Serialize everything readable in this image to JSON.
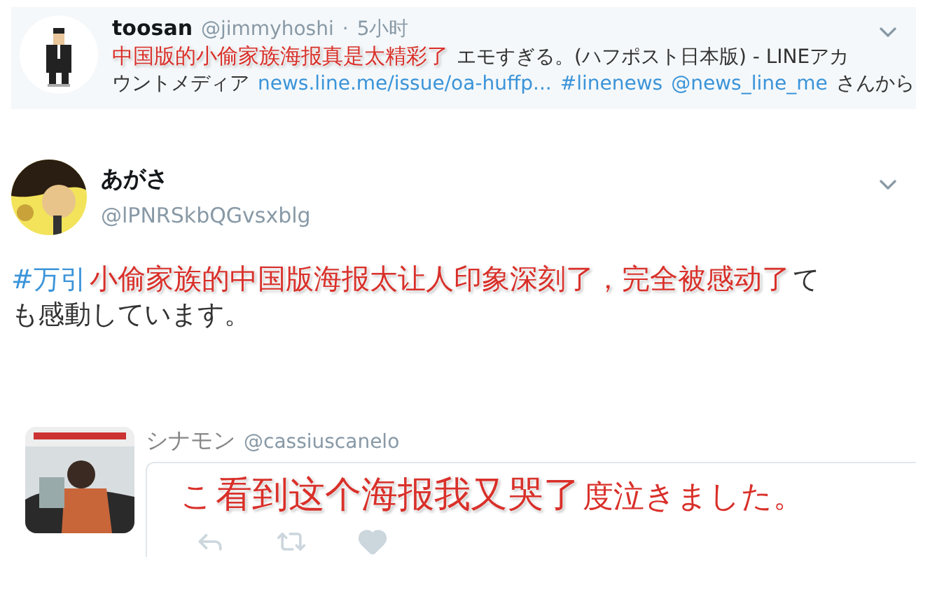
{
  "tweets": [
    {
      "kind": "card",
      "name": "toosan",
      "handle": "@jimmyhoshi",
      "separator": "·",
      "time": "5小时",
      "menu": true,
      "lines": [
        [
          {
            "kind": "caption",
            "text": "中国版的小偷家族海报真是太精彩了"
          },
          {
            "kind": "text",
            "text": "エモすぎる。(ハフポスト日本版) - LINEアカ"
          }
        ],
        [
          {
            "kind": "text",
            "text": "ウントメディア"
          },
          {
            "kind": "link",
            "text": "news.line.me/issue/oa-huffp..."
          },
          {
            "kind": "link",
            "text": "#linenews"
          },
          {
            "kind": "link",
            "text": "@news_line_me"
          },
          {
            "kind": "text",
            "text": "さんから"
          }
        ]
      ]
    },
    {
      "kind": "stacked",
      "name": "あがさ",
      "handle": "@lPNRSkbQGvsxblg",
      "menu": true,
      "lines": [
        [
          {
            "kind": "link",
            "text": "#万引"
          },
          {
            "kind": "caption",
            "text": "小偷家族的中国版海报太让人印象深刻了，完全被感动了"
          },
          {
            "kind": "text",
            "text": "て"
          }
        ],
        [
          {
            "kind": "text",
            "text": "も感動しています。"
          }
        ]
      ]
    },
    {
      "kind": "embedded",
      "name": "シナモン",
      "handle": "@cassiuscanelo",
      "menu": false,
      "lines": [
        [
          {
            "kind": "redtext",
            "text": "こ"
          },
          {
            "kind": "caption",
            "text": "看到这个海报我又哭了"
          },
          {
            "kind": "redtext",
            "text": "度泣きました。"
          }
        ]
      ]
    }
  ]
}
